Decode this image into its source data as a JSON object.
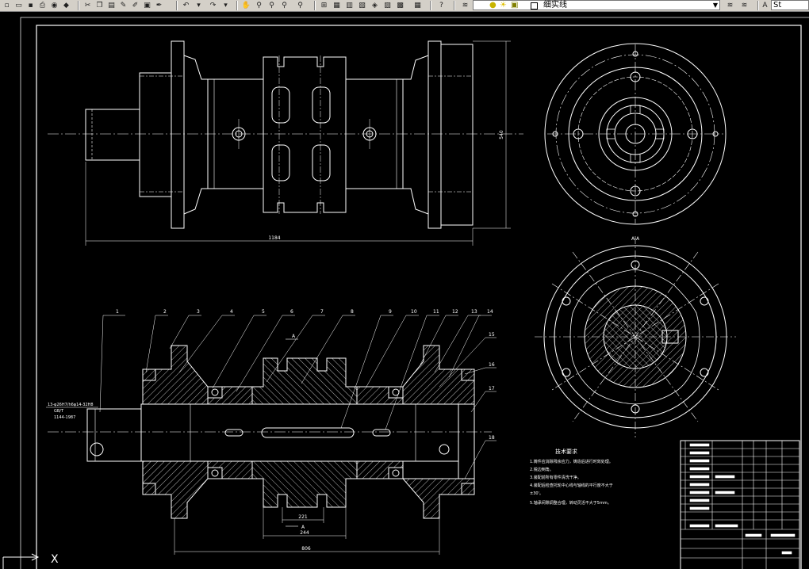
{
  "toolbar": {
    "icons": [
      "new-icon",
      "open-icon",
      "save-icon",
      "plot-icon",
      "cut-icon",
      "copy-icon",
      "paste-icon",
      "matchprop-icon",
      "undo-icon",
      "redo-icon",
      "pan-icon",
      "zoom-realtime-icon",
      "zoom-window-icon",
      "zoom-previous-icon",
      "properties-icon",
      "designcenter-icon",
      "toolpalette-icon",
      "sheetset-icon",
      "calculator-icon",
      "help-icon",
      "layer-manager-icon"
    ],
    "layer_name": "细实线",
    "text_style": "St"
  },
  "drawing": {
    "top_dims": {
      "overall_length": "1184",
      "height": "540"
    },
    "section_label": "A-A",
    "cut_label": "A",
    "part_numbers": [
      "1",
      "2",
      "3",
      "4",
      "5",
      "6",
      "7",
      "8",
      "9",
      "10",
      "11",
      "12",
      "13",
      "14",
      "15",
      "16",
      "17",
      "18"
    ],
    "shaft_notes": [
      "13-φ26H7/h6φ14-32H8",
      "GB/T",
      "1144-1987"
    ],
    "bottom_dims": {
      "d1": "221",
      "d2": "244",
      "overall": "806"
    },
    "tech_req": {
      "title": "技术要求",
      "lines": [
        "1.铸件应消除残余应力，铸造后进行时效处理。",
        "2.锐边倒角。",
        "3.装配前所有零件清洗干净。",
        "4.装配后检查托轮中心线与轴线的平行度不大于",
        "±30'。",
        "5.轴承间隙调整合理，转动灵活不大于5mm。"
      ]
    }
  },
  "cli": {
    "prompt": "X"
  }
}
